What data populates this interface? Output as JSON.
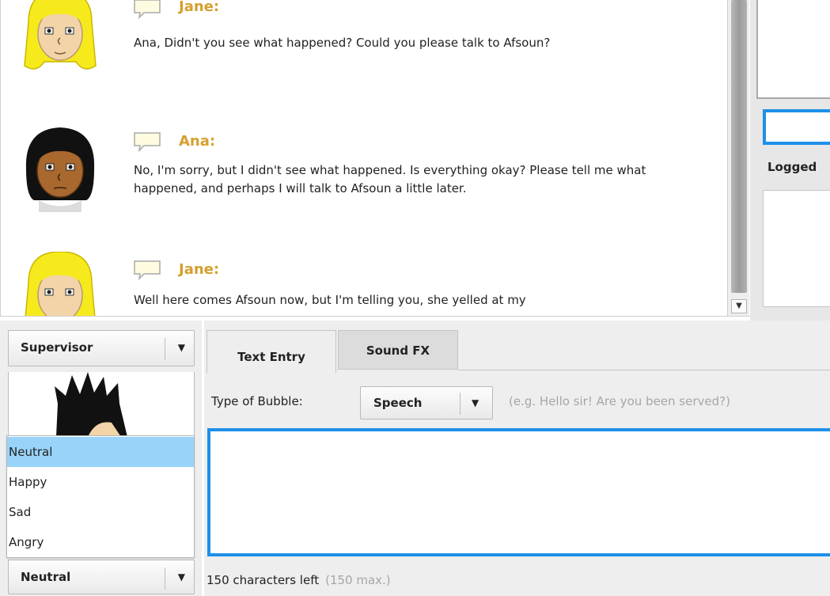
{
  "chat": {
    "messages": [
      {
        "speaker": "Jane:",
        "text": "Ana, Didn't you see what happened? Could you please talk to Afsoun?"
      },
      {
        "speaker": "Ana:",
        "text": "No, I'm sorry, but I didn't see what happened.  Is everything okay? Please tell me what happened, and perhaps I will talk to Afsoun a little later."
      },
      {
        "speaker": "Jane:",
        "text": "Well here comes Afsoun now, but I'm telling you, she yelled at my"
      }
    ]
  },
  "right_panel": {
    "logged_label": "Logged"
  },
  "character_panel": {
    "character_selected": "Supervisor",
    "mood_options": [
      "Neutral",
      "Happy",
      "Sad",
      "Angry"
    ],
    "mood_highlighted": "Neutral",
    "mood_selected": "Neutral"
  },
  "entry_panel": {
    "tabs": [
      "Text Entry",
      "Sound FX"
    ],
    "active_tab": "Text Entry",
    "bubble_label": "Type of Bubble:",
    "bubble_type": "Speech",
    "hint": "(e.g. Hello sir! Are you been served?)",
    "chars_left": "150 characters left",
    "chars_max": "(150 max.)",
    "textarea_value": ""
  },
  "colors": {
    "speaker_name": "#d5a02f",
    "focus_border": "#1e90e8",
    "selected_option": "#99d3fa",
    "panel_bg": "#eeeeee"
  },
  "icons": [
    "speech-bubble-icon",
    "dropdown-arrow-icon",
    "scroll-down-arrow-icon"
  ]
}
